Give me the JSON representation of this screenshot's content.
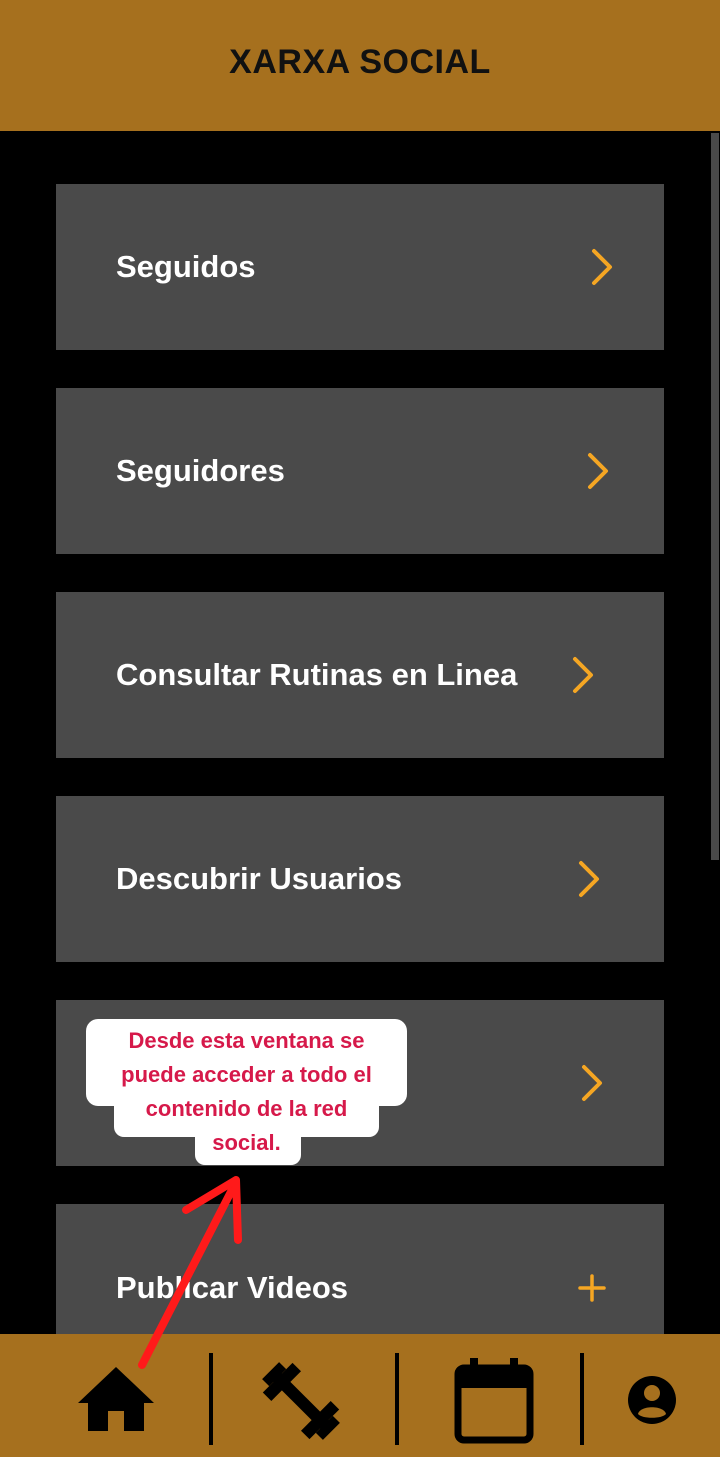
{
  "header": {
    "title": "XARXA SOCIAL"
  },
  "menu": [
    {
      "label": "Seguidos",
      "icon": "chevron-right-icon"
    },
    {
      "label": "Seguidores",
      "icon": "chevron-right-icon"
    },
    {
      "label": "Consultar Rutinas en Linea",
      "icon": "chevron-right-icon"
    },
    {
      "label": "Descubrir Usuarios",
      "icon": "chevron-right-icon"
    },
    {
      "label": "",
      "icon": "chevron-right-icon"
    },
    {
      "label": "Publicar Videos",
      "icon": "plus-icon"
    }
  ],
  "callout": {
    "lines": [
      "Desde esta ventana se",
      "puede acceder a todo el",
      "contenido de la red",
      "social."
    ]
  },
  "bottom_nav": [
    {
      "name": "home",
      "icon": "home-icon"
    },
    {
      "name": "workouts",
      "icon": "dumbbell-icon"
    },
    {
      "name": "calendar",
      "icon": "calendar-icon"
    },
    {
      "name": "profile",
      "icon": "account-icon"
    }
  ],
  "colors": {
    "header_bg": "#a6701e",
    "card_bg": "#4a4a4a",
    "accent": "#f5a623",
    "callout_text": "#d6194a",
    "arrow": "#ff1a1a"
  }
}
